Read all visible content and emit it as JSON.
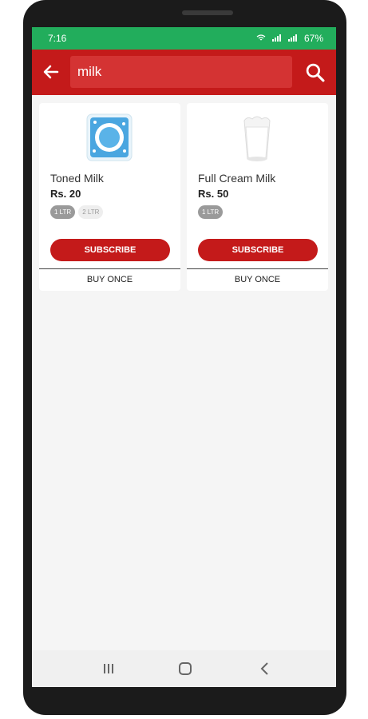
{
  "status": {
    "time": "7:16",
    "battery": "67%",
    "network_icons": "wifi-icon signal-icon"
  },
  "search": {
    "value": "milk",
    "placeholder": ""
  },
  "colors": {
    "statusbar": "#22ad5c",
    "appbar": "#c41a1a",
    "accent": "#c41a1a"
  },
  "products": [
    {
      "name": "Toned Milk",
      "price": "Rs. 20",
      "variants": [
        "1 LTR",
        "2 LTR"
      ],
      "selected_variant": "1 LTR",
      "subscribe_label": "SUBSCRIBE",
      "buy_once_label": "BUY ONCE",
      "image_icon": "milk-packet-icon"
    },
    {
      "name": "Full Cream Milk",
      "price": "Rs. 50",
      "variants": [
        "1 LTR"
      ],
      "selected_variant": "1 LTR",
      "subscribe_label": "SUBSCRIBE",
      "buy_once_label": "BUY ONCE",
      "image_icon": "milk-glass-icon"
    }
  ]
}
